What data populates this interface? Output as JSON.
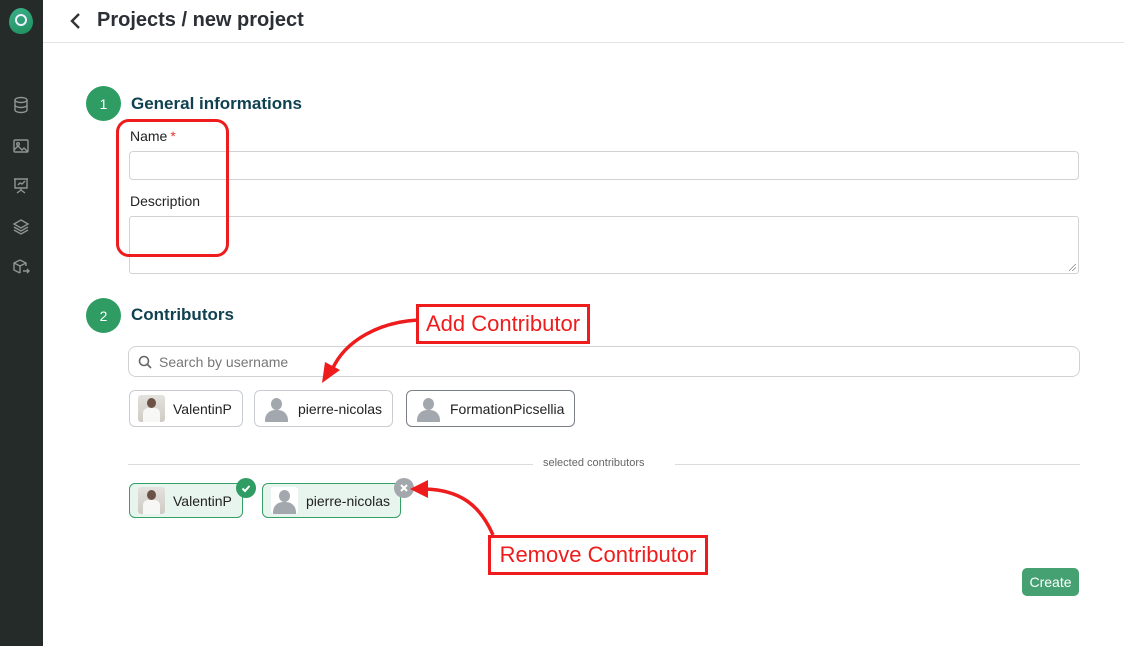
{
  "header": {
    "title": "Projects / new project"
  },
  "sidebar": {
    "items": [
      {
        "name": "datalake",
        "icon": "database-icon"
      },
      {
        "name": "datasets",
        "icon": "image-icon"
      },
      {
        "name": "experiments",
        "icon": "presentation-chart-icon"
      },
      {
        "name": "models",
        "icon": "layers-icon"
      },
      {
        "name": "deployments",
        "icon": "box-arrow-icon"
      }
    ]
  },
  "section1": {
    "step": "1",
    "title": "General informations",
    "name_label": "Name",
    "required_mark": "*",
    "name_value": "",
    "description_label": "Description",
    "description_value": ""
  },
  "section2": {
    "step": "2",
    "title": "Contributors",
    "search_placeholder": "Search by username",
    "available": [
      {
        "username": "ValentinP",
        "avatar": "photo"
      },
      {
        "username": "pierre-nicolas",
        "avatar": "default"
      },
      {
        "username": "FormationPicsellia",
        "avatar": "default"
      }
    ],
    "selected_label": "selected contributors",
    "selected": [
      {
        "username": "ValentinP",
        "avatar": "photo",
        "badge": "check"
      },
      {
        "username": "pierre-nicolas",
        "avatar": "default",
        "badge": "remove"
      }
    ]
  },
  "actions": {
    "create": "Create"
  },
  "annotations": {
    "add": "Add Contributor",
    "remove": "Remove Contributor",
    "color": "#ee1c1c"
  },
  "colors": {
    "accent": "#2e9c63",
    "sidebar": "#252b29",
    "heading": "#0f4150"
  }
}
